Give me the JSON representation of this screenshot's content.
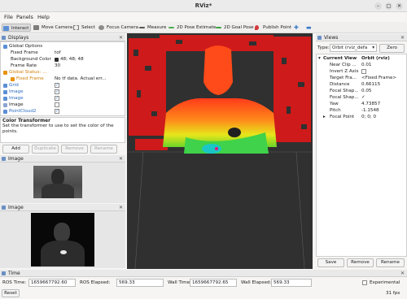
{
  "window": {
    "title": "RViz*"
  },
  "menu": [
    "File",
    "Panels",
    "Help"
  ],
  "toolbar": {
    "interact": "Interact",
    "move_camera": "Move Camera",
    "select": "Select",
    "focus_camera": "Focus Camera",
    "measure": "Measure",
    "pose_estimate": "2D Pose Estimate",
    "goal_pose": "2D Goal Pose",
    "publish_point": "Publish Point"
  },
  "displays": {
    "title": "Displays",
    "rows": [
      {
        "key": "Global Options",
        "value": ""
      },
      {
        "key": "Fixed Frame",
        "value": "tof"
      },
      {
        "key": "Background Color",
        "value": "48; 48; 48"
      },
      {
        "key": "Frame Rate",
        "value": "30"
      },
      {
        "key": "Global Status: ...",
        "value": ""
      },
      {
        "key": "Fixed Frame",
        "value": "No tf data.  Actual err..."
      },
      {
        "key": "Grid",
        "value": ""
      },
      {
        "key": "Image",
        "value": ""
      },
      {
        "key": "Image",
        "value": ""
      },
      {
        "key": "Image",
        "value": ""
      },
      {
        "key": "PointCloud2",
        "value": ""
      }
    ],
    "desc_title": "Color Transformer",
    "desc_text": "Set the transformer to use to set the color of the points.",
    "buttons": [
      "Add",
      "Duplicate",
      "Remove",
      "Rename"
    ]
  },
  "image_panels": [
    {
      "title": "Image"
    },
    {
      "title": "Image"
    }
  ],
  "views": {
    "title": "Views",
    "type_label": "Type:",
    "type_value": "Orbit (rviz_defa",
    "zero_label": "Zero",
    "rows": [
      {
        "key": "Current View",
        "value": "Orbit (rviz)"
      },
      {
        "key": "Near Clip ...",
        "value": "0.01"
      },
      {
        "key": "Invert Z Axis",
        "value": ""
      },
      {
        "key": "Target Fra...",
        "value": "<Fixed Frame>"
      },
      {
        "key": "Distance",
        "value": "0.66115"
      },
      {
        "key": "Focal Shap...",
        "value": "0.05"
      },
      {
        "key": "Focal Shap...",
        "value": "✓"
      },
      {
        "key": "Yaw",
        "value": "4.73857"
      },
      {
        "key": "Pitch",
        "value": "-1.1548"
      },
      {
        "key": "Focal Point",
        "value": "0; 0; 0"
      }
    ],
    "buttons": [
      "Save",
      "Remove",
      "Rename"
    ]
  },
  "time": {
    "title": "Time",
    "ros_time_label": "ROS Time:",
    "ros_time": "1659667792.60",
    "ros_elapsed_label": "ROS Elapsed:",
    "ros_elapsed": "569.33",
    "wall_time_label": "Wall Time:",
    "wall_time": "1659667792.65",
    "wall_elapsed_label": "Wall Elapsed:",
    "wall_elapsed": "569.33",
    "experimental": "Experimental",
    "reset": "Reset",
    "fps": "31 fps"
  }
}
